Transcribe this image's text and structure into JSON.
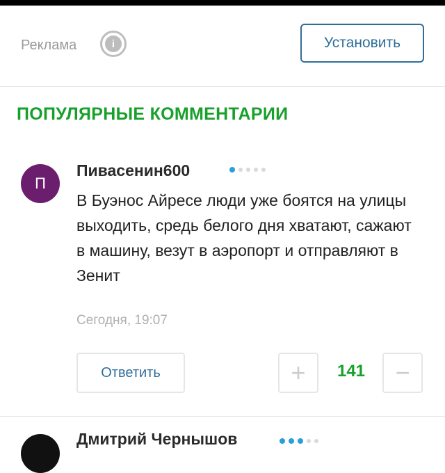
{
  "ad": {
    "label": "Реклама",
    "icon": "info-icon",
    "install_button": "Установить"
  },
  "section_title": "ПОПУЛЯРНЫЕ КОММЕНТАРИИ",
  "comments": [
    {
      "avatar_letter": "П",
      "avatar_color": "#6b1e6d",
      "author": "Пивасенин600",
      "rating_dots_on": 1,
      "text": "В Буэнос Айресе люди уже боятся на улицы выходить, средь белого дня хватают, сажают в машину, везут в аэропорт и отправляют в Зенит",
      "time": "Сегодня, 19:07",
      "reply_label": "Ответить",
      "plus_label": "+",
      "score": "141",
      "minus_label": "−"
    },
    {
      "avatar_color": "#111111",
      "author": "Дмитрий Чернышов",
      "rating_dots_on": 3
    }
  ],
  "colors": {
    "accent_green": "#17a02a",
    "link_blue": "#2f6e9a",
    "rating_blue": "#2a9fdb"
  }
}
